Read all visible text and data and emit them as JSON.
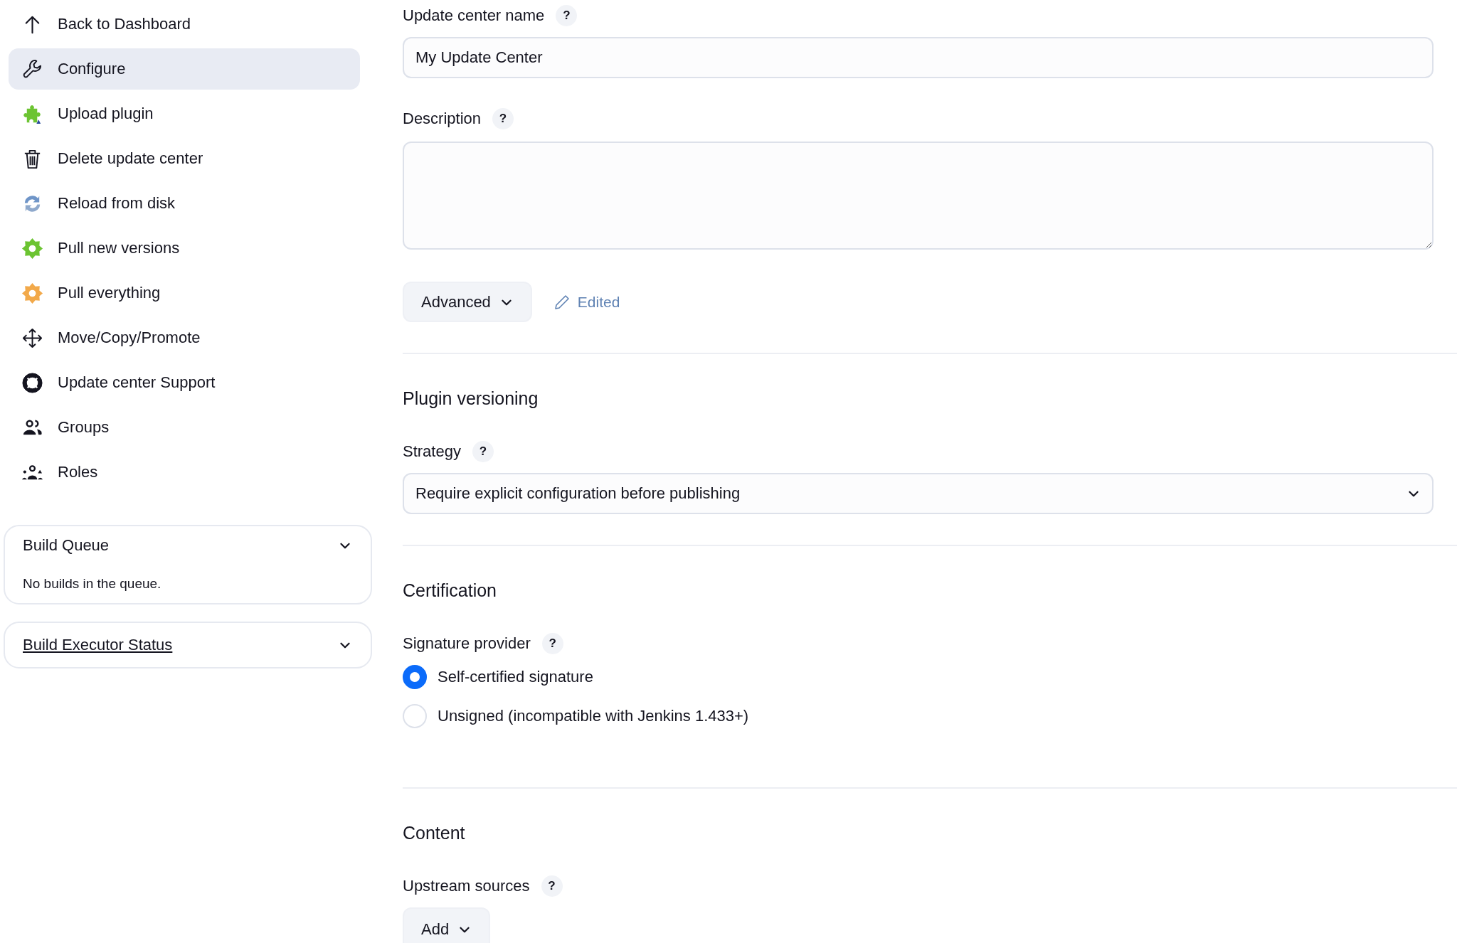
{
  "sidebar": {
    "items": [
      {
        "label": "Back to Dashboard",
        "selected": false
      },
      {
        "label": "Configure",
        "selected": true
      },
      {
        "label": "Upload plugin",
        "selected": false
      },
      {
        "label": "Delete update center",
        "selected": false
      },
      {
        "label": "Reload from disk",
        "selected": false
      },
      {
        "label": "Pull new versions",
        "selected": false
      },
      {
        "label": "Pull everything",
        "selected": false
      },
      {
        "label": "Move/Copy/Promote",
        "selected": false
      },
      {
        "label": "Update center Support",
        "selected": false
      },
      {
        "label": "Groups",
        "selected": false
      },
      {
        "label": "Roles",
        "selected": false
      }
    ],
    "widgets": [
      {
        "kind": "plain",
        "title": "Build Queue",
        "body": "No builds in the queue."
      },
      {
        "kind": "link",
        "title": "Build Executor Status"
      }
    ]
  },
  "form": {
    "name_field": {
      "label": "Update center name",
      "help": "?",
      "value": "My Update Center"
    },
    "description_field": {
      "label": "Description",
      "help": "?"
    },
    "advanced_button": "Advanced",
    "edited_note": "Edited",
    "sections": [
      {
        "title": "Plugin versioning",
        "fields": [
          {
            "kind": "select",
            "label": "Strategy",
            "help": "?",
            "value": "Require explicit configuration before publishing"
          }
        ]
      },
      {
        "title": "Certification",
        "fields": [
          {
            "kind": "radio",
            "label": "Signature provider",
            "help": "?",
            "options": [
              {
                "label": "Self-certified signature",
                "selected": true
              },
              {
                "label": "Unsigned (incompatible with Jenkins 1.433+)",
                "selected": false
              }
            ]
          }
        ]
      },
      {
        "title": "Content",
        "fields": [
          {
            "kind": "button",
            "label": "Upstream sources",
            "help": "?",
            "button": "Add"
          }
        ]
      }
    ]
  }
}
